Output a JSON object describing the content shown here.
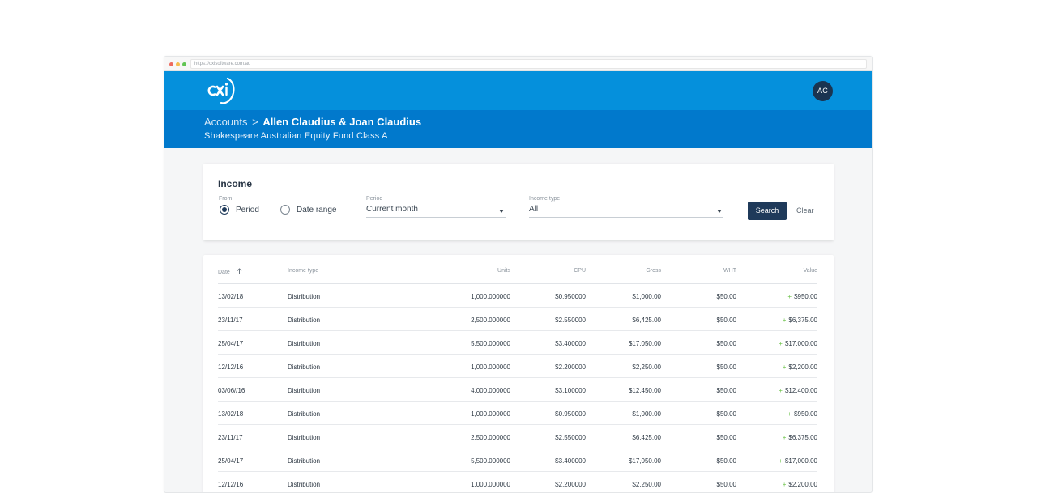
{
  "browser": {
    "url": "https://cxisoftware.com.au"
  },
  "header": {
    "logo_icon": "cxi-logo",
    "avatar_initials": "AC"
  },
  "account": {
    "breadcrumb_parent": "Accounts",
    "breadcrumb_separator": ">",
    "breadcrumb_current": "Allen Claudius & Joan Claudius",
    "fund_name": "Shakespeare Australian Equity Fund Class A"
  },
  "filter": {
    "title": "Income",
    "from_label": "From",
    "radio_period": "Period",
    "radio_date_range": "Date range",
    "selected": "Period",
    "period_label": "Period",
    "period_value": "Current month",
    "income_type_label": "Income type",
    "income_type_value": "All",
    "search_label": "Search",
    "clear_label": "Clear"
  },
  "table": {
    "columns": {
      "date": "Date",
      "income_type": "Income type",
      "units": "Units",
      "cpu": "CPU",
      "gross": "Gross",
      "wht": "WHT",
      "value": "Value"
    },
    "value_prefix": "+",
    "rows": [
      {
        "date": "13/02/18",
        "income_type": "Distribution",
        "units": "1,000.000000",
        "cpu": "$0.950000",
        "gross": "$1,000.00",
        "wht": "$50.00",
        "value": "$950.00"
      },
      {
        "date": "23/11/17",
        "income_type": "Distribution",
        "units": "2,500.000000",
        "cpu": "$2.550000",
        "gross": "$6,425.00",
        "wht": "$50.00",
        "value": "$6,375.00"
      },
      {
        "date": "25/04/17",
        "income_type": "Distribution",
        "units": "5,500.000000",
        "cpu": "$3.400000",
        "gross": "$17,050.00",
        "wht": "$50.00",
        "value": "$17,000.00"
      },
      {
        "date": "12/12/16",
        "income_type": "Distribution",
        "units": "1,000.000000",
        "cpu": "$2.200000",
        "gross": "$2,250.00",
        "wht": "$50.00",
        "value": "$2,200.00"
      },
      {
        "date": "03/06//16",
        "income_type": "Distribution",
        "units": "4,000.000000",
        "cpu": "$3.100000",
        "gross": "$12,450.00",
        "wht": "$50.00",
        "value": "$12,400.00"
      },
      {
        "date": "13/02/18",
        "income_type": "Distribution",
        "units": "1,000.000000",
        "cpu": "$0.950000",
        "gross": "$1,000.00",
        "wht": "$50.00",
        "value": "$950.00"
      },
      {
        "date": "23/11/17",
        "income_type": "Distribution",
        "units": "2,500.000000",
        "cpu": "$2.550000",
        "gross": "$6,425.00",
        "wht": "$50.00",
        "value": "$6,375.00"
      },
      {
        "date": "25/04/17",
        "income_type": "Distribution",
        "units": "5,500.000000",
        "cpu": "$3.400000",
        "gross": "$17,050.00",
        "wht": "$50.00",
        "value": "$17,000.00"
      },
      {
        "date": "12/12/16",
        "income_type": "Distribution",
        "units": "1,000.000000",
        "cpu": "$2.200000",
        "gross": "$2,250.00",
        "wht": "$50.00",
        "value": "$2,200.00"
      }
    ]
  }
}
